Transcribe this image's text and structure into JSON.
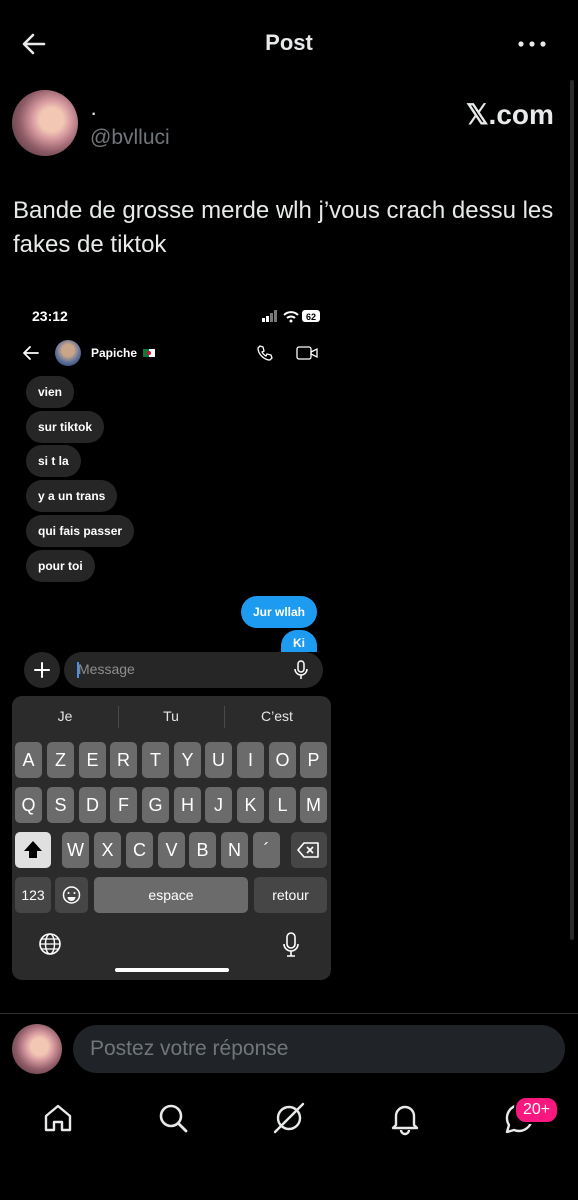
{
  "header": {
    "title": "Post"
  },
  "author": {
    "display_name": "·",
    "handle": "@bvlluci",
    "brand": "𝕏.com"
  },
  "post": {
    "text": "Bande de grosse merde wlh j’vous crach dessu les fakes de tiktok"
  },
  "screenshot": {
    "time": "23:12",
    "battery": "62",
    "contact_name": "Papiche",
    "received": [
      "vien",
      "sur tiktok",
      "si t la",
      "y a un trans",
      "qui fais passer",
      "pour toi"
    ],
    "sent": [
      "Jur wllah",
      "Ki"
    ],
    "composer_placeholder": "Message",
    "suggestions": [
      "Je",
      "Tu",
      "C’est"
    ],
    "row1": [
      "A",
      "Z",
      "E",
      "R",
      "T",
      "Y",
      "U",
      "I",
      "O",
      "P"
    ],
    "row2": [
      "Q",
      "S",
      "D",
      "F",
      "G",
      "H",
      "J",
      "K",
      "L",
      "M"
    ],
    "row3": [
      "W",
      "X",
      "C",
      "V",
      "B",
      "N",
      "´"
    ],
    "key_123": "123",
    "key_space": "espace",
    "key_return": "retour"
  },
  "reply": {
    "placeholder": "Postez votre réponse"
  },
  "tabbar": {
    "items": [
      "home-icon",
      "search-icon",
      "grok-icon",
      "notifications-icon",
      "messages-icon"
    ],
    "badge": "20+"
  },
  "colors": {
    "accent": "#1d9bf0",
    "badge": "#f91880",
    "background": "#000000"
  }
}
